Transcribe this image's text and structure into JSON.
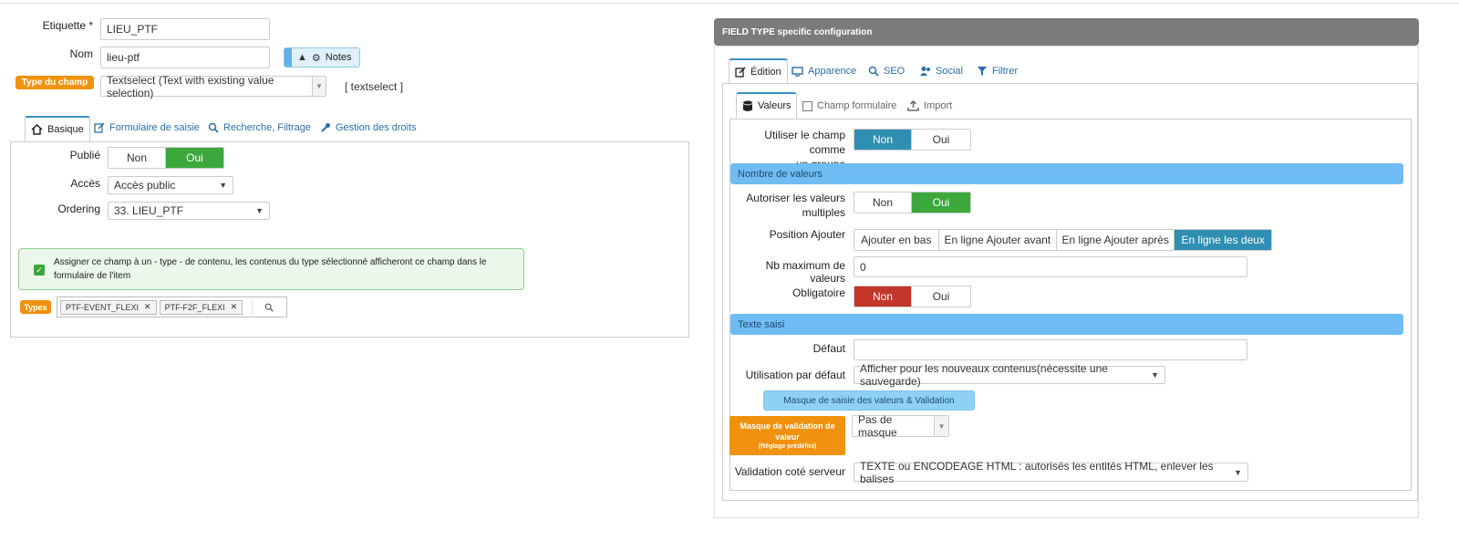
{
  "left": {
    "etiquette_label": "Etiquette *",
    "etiquette_value": "LIEU_PTF",
    "nom_label": "Nom",
    "nom_value": "lieu-ptf",
    "notes_label": "Notes",
    "type_badge": "Type du champ",
    "type_value": "Textselect (Text with existing value selection)",
    "type_code": "[ textselect ]",
    "tabs": [
      {
        "label": "Basique",
        "icon": "home-icon"
      },
      {
        "label": "Formulaire de saisie",
        "icon": "edit-icon"
      },
      {
        "label": "Recherche, Filtrage",
        "icon": "search-icon"
      },
      {
        "label": "Gestion des droits",
        "icon": "wrench-icon"
      }
    ],
    "publie_label": "Publié",
    "publie_options": [
      "Non",
      "Oui"
    ],
    "publie_selected": "Oui",
    "acces_label": "Accès",
    "acces_value": "Accès public",
    "ordering_label": "Ordering",
    "ordering_value": "33. LIEU_PTF",
    "assign_text": "Assigner ce champ à un - type - de contenu, les contenus du type sélectionné afficheront ce champ dans le formulaire de l'item",
    "types_badge": "Types",
    "types_tags": [
      "PTF-EVENT_FLEXI",
      "PTF-F2F_FLEXI"
    ]
  },
  "right": {
    "header": "FIELD TYPE specific configuration",
    "tabs": [
      {
        "label": "Édition",
        "icon": "edit-icon"
      },
      {
        "label": "Apparence",
        "icon": "monitor-icon"
      },
      {
        "label": "SEO",
        "icon": "search-icon"
      },
      {
        "label": "Social",
        "icon": "users-icon"
      },
      {
        "label": "Filtrer",
        "icon": "filter-icon"
      }
    ],
    "subtabs": [
      {
        "label": "Valeurs",
        "icon": "database-icon"
      },
      {
        "label": "Champ formulaire",
        "icon": "checkbox-icon"
      },
      {
        "label": "Import",
        "icon": "upload-icon"
      }
    ],
    "groupe_label_1": "Utiliser le champ comme",
    "groupe_label_2": "un groupe",
    "groupe_options": [
      "Non",
      "Oui"
    ],
    "section_nombre": "Nombre de valeurs",
    "multiples_label_1": "Autoriser les valeurs",
    "multiples_label_2": "multiples",
    "multiples_options": [
      "Non",
      "Oui"
    ],
    "position_label": "Position Ajouter",
    "position_options": [
      "Ajouter en bas",
      "En ligne Ajouter avant",
      "En ligne Ajouter après",
      "En ligne les deux"
    ],
    "nbmax_label": "Nb maximum de valeurs",
    "nbmax_value": "0",
    "obligatoire_label": "Obligatoire",
    "obligatoire_options": [
      "Non",
      "Oui"
    ],
    "section_texte": "Texte saisi",
    "defaut_label": "Défaut",
    "defaut_value": "",
    "utilisation_label": "Utilisation par défaut",
    "utilisation_value": "Afficher pour les nouveaux contenus(nécessite une sauvegarde)",
    "masque_button": "Masque de saisie des valeurs & Validation",
    "masque_badge_1": "Masque de validation de valeur",
    "masque_badge_2": "(Réglage prédéfini)",
    "masque_value": "Pas de masque",
    "validation_label": "Validation coté serveur",
    "validation_value": "TEXTE ou ENCODEAGE HTML : autorisés les entités HTML, enlever les balises"
  },
  "colors": {
    "accent_blue": "#2f8fb3",
    "green": "#3ca83c",
    "red": "#c4352a",
    "orange": "#f0920e",
    "section": "#6fbcf4"
  }
}
